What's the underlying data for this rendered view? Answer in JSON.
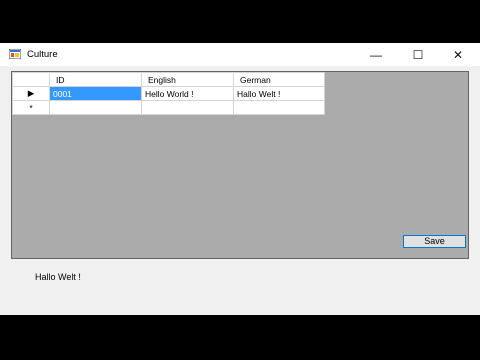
{
  "window": {
    "title": "Culture",
    "controls": {
      "minimize": "—",
      "maximize": "☐",
      "close": "✕"
    }
  },
  "grid": {
    "columns": [
      "ID",
      "English",
      "German"
    ],
    "rows": [
      {
        "indicator": "▶",
        "cells": [
          "0001",
          "Hello World !",
          "Hallo Welt !"
        ]
      },
      {
        "indicator": "*",
        "cells": [
          "",
          "",
          ""
        ]
      }
    ]
  },
  "save_button": {
    "label": "Save"
  },
  "result_label": "Hallo Welt !"
}
